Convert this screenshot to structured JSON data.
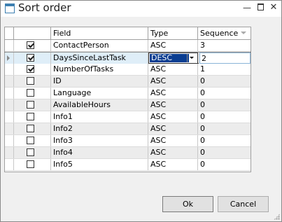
{
  "window": {
    "title": "Sort order"
  },
  "titlebar": {
    "min_icon": "minimize-icon",
    "max_icon": "maximize-icon",
    "close_icon": "close-icon",
    "close_glyph": "✕",
    "min_glyph": "—"
  },
  "grid": {
    "columns": [
      {
        "key": "rowsel",
        "label": ""
      },
      {
        "key": "check",
        "label": ""
      },
      {
        "key": "field",
        "label": "Field"
      },
      {
        "key": "type",
        "label": "Type"
      },
      {
        "key": "seq",
        "label": "Sequence"
      }
    ],
    "current_row": 1,
    "rows": [
      {
        "checked": true,
        "field": "ContactPerson",
        "type": "ASC",
        "seq": "3"
      },
      {
        "checked": true,
        "field": "DaysSinceLastTask",
        "type": "DESC",
        "seq": "2"
      },
      {
        "checked": true,
        "field": "NumberOfTasks",
        "type": "ASC",
        "seq": "1"
      },
      {
        "checked": false,
        "field": "ID",
        "type": "ASC",
        "seq": "0"
      },
      {
        "checked": false,
        "field": "Language",
        "type": "ASC",
        "seq": "0"
      },
      {
        "checked": false,
        "field": "AvailableHours",
        "type": "ASC",
        "seq": "0"
      },
      {
        "checked": false,
        "field": "Info1",
        "type": "ASC",
        "seq": "0"
      },
      {
        "checked": false,
        "field": "Info2",
        "type": "ASC",
        "seq": "0"
      },
      {
        "checked": false,
        "field": "Info3",
        "type": "ASC",
        "seq": "0"
      },
      {
        "checked": false,
        "field": "Info4",
        "type": "ASC",
        "seq": "0"
      },
      {
        "checked": false,
        "field": "Info5",
        "type": "ASC",
        "seq": "0"
      }
    ]
  },
  "buttons": {
    "ok": "Ok",
    "cancel": "Cancel"
  },
  "colors": {
    "accent": "#3c7fb1",
    "selection": "#0a3d91"
  }
}
